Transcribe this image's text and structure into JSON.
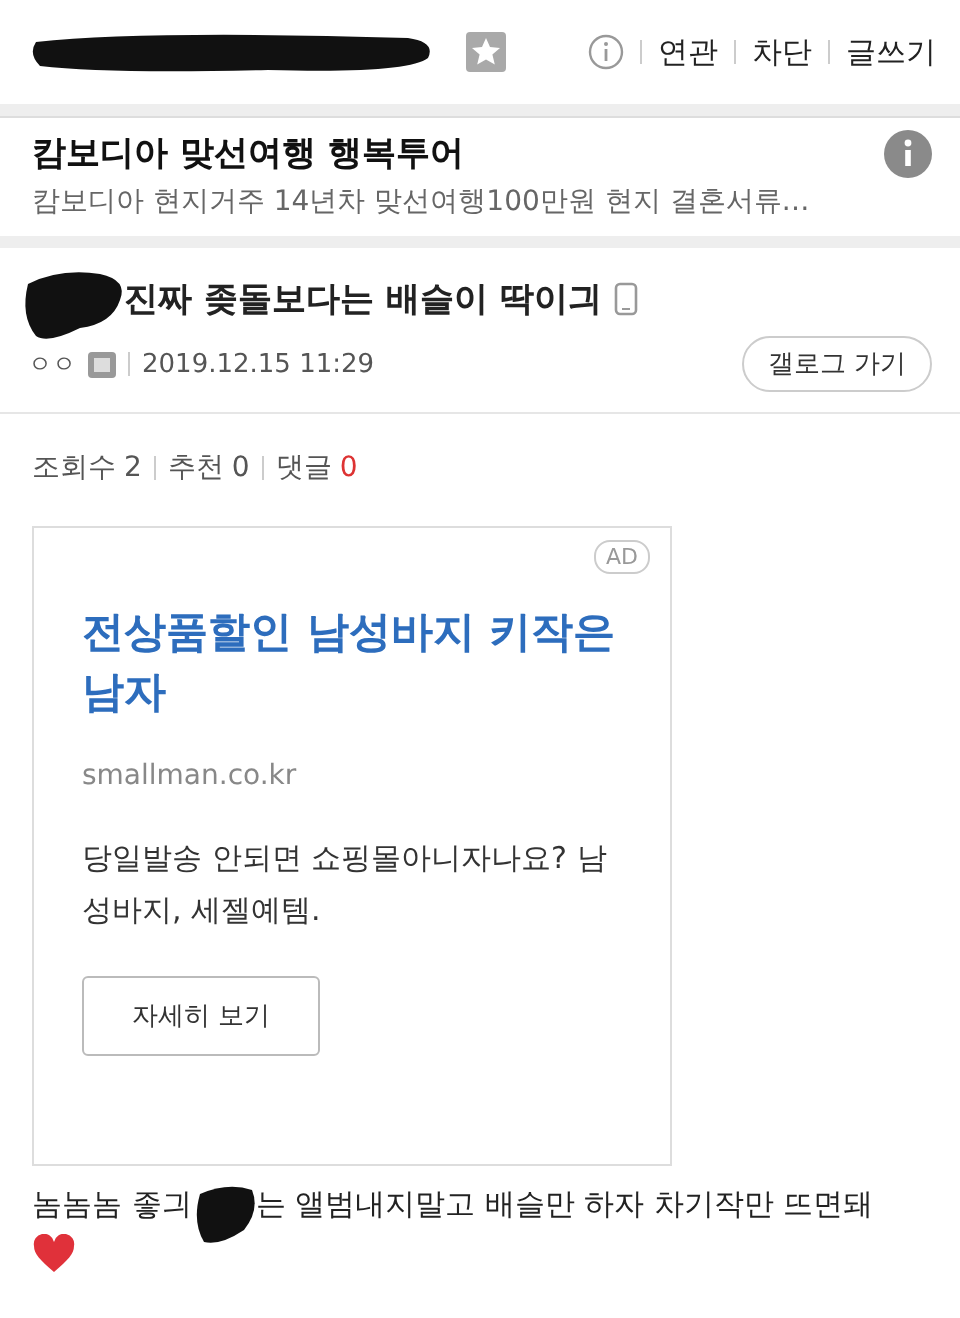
{
  "header": {
    "links": [
      {
        "label": "연관"
      },
      {
        "label": "차단"
      },
      {
        "label": "글쓰기"
      }
    ]
  },
  "promo": {
    "title": "캄보디아 맞선여행 행복투어",
    "text": "캄보디아 현지거주 14년차 맞선여행100만원 현지 결혼서류…"
  },
  "post": {
    "title": "진짜 좆돌보다는 배슬이 딱이긔",
    "author": "ㅇㅇ",
    "date": "2019.12.15 11:29",
    "gallery_button": "갤로그 가기"
  },
  "stats": [
    {
      "label": "조회수",
      "value": "2",
      "kind": "plain"
    },
    {
      "label": "추천",
      "value": "0",
      "kind": "plain"
    },
    {
      "label": "댓글",
      "value": "0",
      "kind": "accent"
    }
  ],
  "ad": {
    "badge": "AD",
    "title": "전상품할인 남성바지 키작은 남자",
    "domain": "smallman.co.kr",
    "text": "당일발송 안되면 쇼핑몰아니자나요? 남성바지, 세젤예템.",
    "button": "자세히 보기"
  },
  "comment": {
    "before": "놈놈놈 좋긔",
    "after": "는 앨범내지말고 배슬만 하자 차기작만 뜨면돼"
  }
}
